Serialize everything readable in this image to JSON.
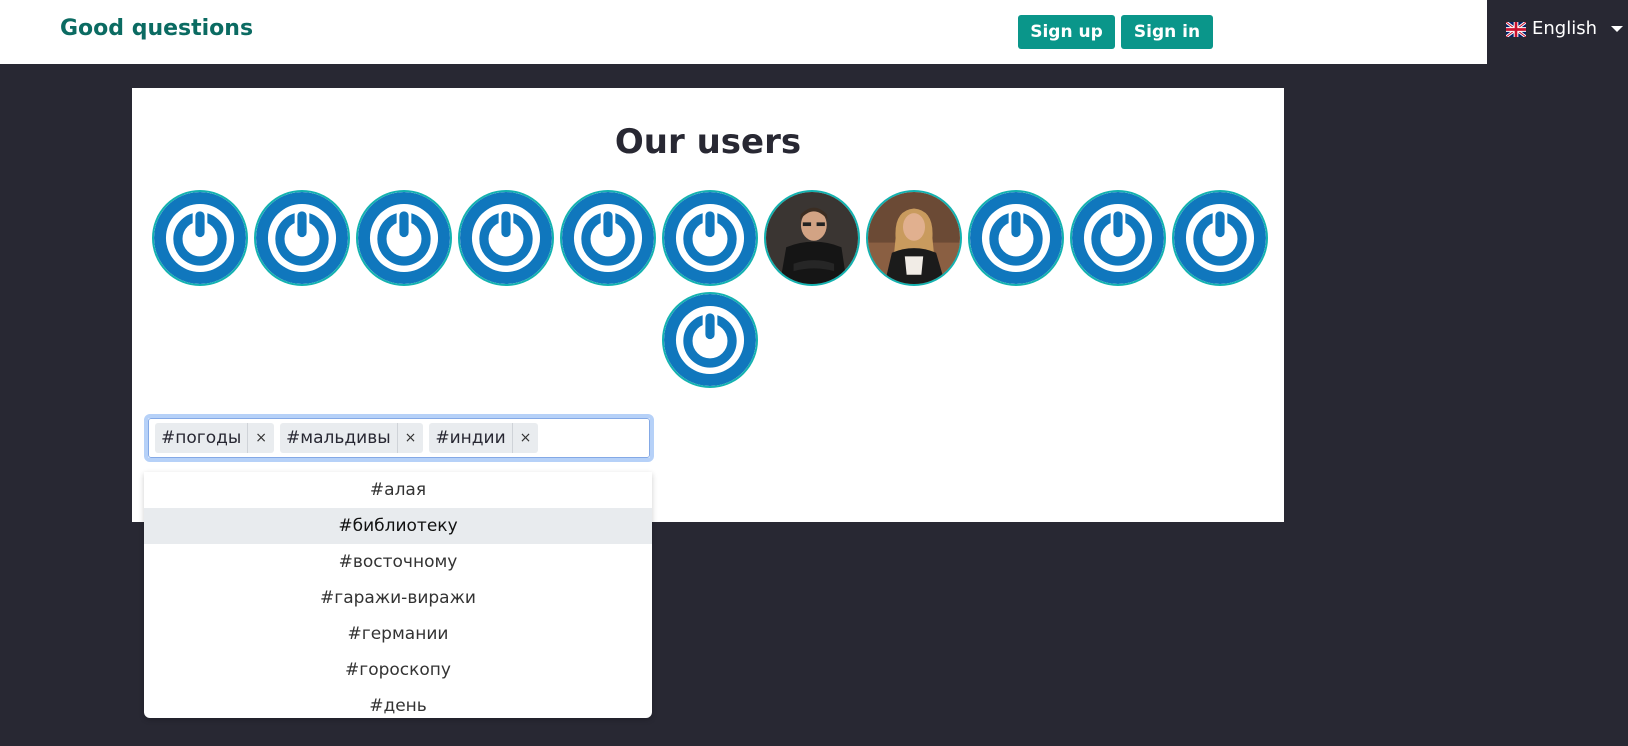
{
  "header": {
    "brand": "Good questions",
    "sign_up_label": "Sign up",
    "sign_in_label": "Sign in",
    "language": "English",
    "flag_icon": "uk-flag-icon"
  },
  "main": {
    "title": "Our users",
    "users": [
      {
        "avatar": "power-icon"
      },
      {
        "avatar": "power-icon"
      },
      {
        "avatar": "power-icon"
      },
      {
        "avatar": "power-icon"
      },
      {
        "avatar": "power-icon"
      },
      {
        "avatar": "power-icon"
      },
      {
        "avatar": "photo-man"
      },
      {
        "avatar": "photo-woman"
      },
      {
        "avatar": "power-icon"
      },
      {
        "avatar": "power-icon"
      },
      {
        "avatar": "power-icon"
      },
      {
        "avatar": "power-icon"
      }
    ]
  },
  "tag_input": {
    "tags": [
      "#погоды",
      "#мальдивы",
      "#индии"
    ],
    "remove_symbol": "×",
    "value": ""
  },
  "suggestions": {
    "items": [
      "#алая",
      "#библиотеку",
      "#восточному",
      "#гаражи-виражи",
      "#германии",
      "#гороскопу",
      "#день"
    ],
    "active_index": 1
  },
  "colors": {
    "accent": "#0a968a",
    "brand": "#0b6b62",
    "background": "#282833",
    "avatar_ring": "#14b2b0",
    "avatar_blue": "#1077bd"
  }
}
